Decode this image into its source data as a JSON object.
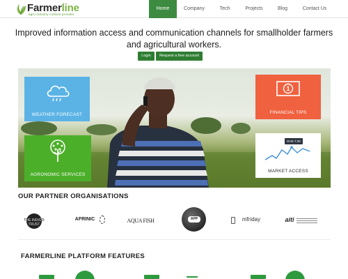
{
  "brand": {
    "name_a": "Farmer",
    "name_b": "line",
    "tagline": "agro-industry content provider"
  },
  "nav": {
    "items": [
      {
        "label": "Home",
        "active": true
      },
      {
        "label": "Company",
        "active": false
      },
      {
        "label": "Tech",
        "active": false
      },
      {
        "label": "Projects",
        "active": false
      },
      {
        "label": "Blog",
        "active": false
      },
      {
        "label": "Contact Us",
        "active": false
      }
    ]
  },
  "hero": {
    "headline": "Improved information access and communication channels for smallholder farmers and agricultural workers.",
    "login_label": "Login",
    "request_label": "Request a free account"
  },
  "banner": {
    "weather_label": "WEATHER FORECAST",
    "financial_label": "FINANCIAL TIPS",
    "agronomic_label": "AGRONOMIC SERVICES",
    "market_label": "MARKET ACCESS",
    "market_price": "GHS 7.00",
    "financial_glyph": "1"
  },
  "partners": {
    "title": "OUR PARTNER ORGANISATIONS",
    "items": [
      {
        "name": "the indigo trust"
      },
      {
        "name": "AFRINIC"
      },
      {
        "name": "AQUA FISH"
      },
      {
        "name": "APP"
      },
      {
        "name": "mfriday"
      },
      {
        "name": "aiti"
      }
    ]
  },
  "features": {
    "title": "FARMERLINE PLATFORM FEATURES"
  },
  "colors": {
    "nav_active": "#3d8b40",
    "button_green": "#2e7d32",
    "weather_tile": "#5bb3e5",
    "financial_tile": "#f0613f",
    "agronomic_tile": "#4caf2a",
    "market_tile": "#ffffff"
  }
}
